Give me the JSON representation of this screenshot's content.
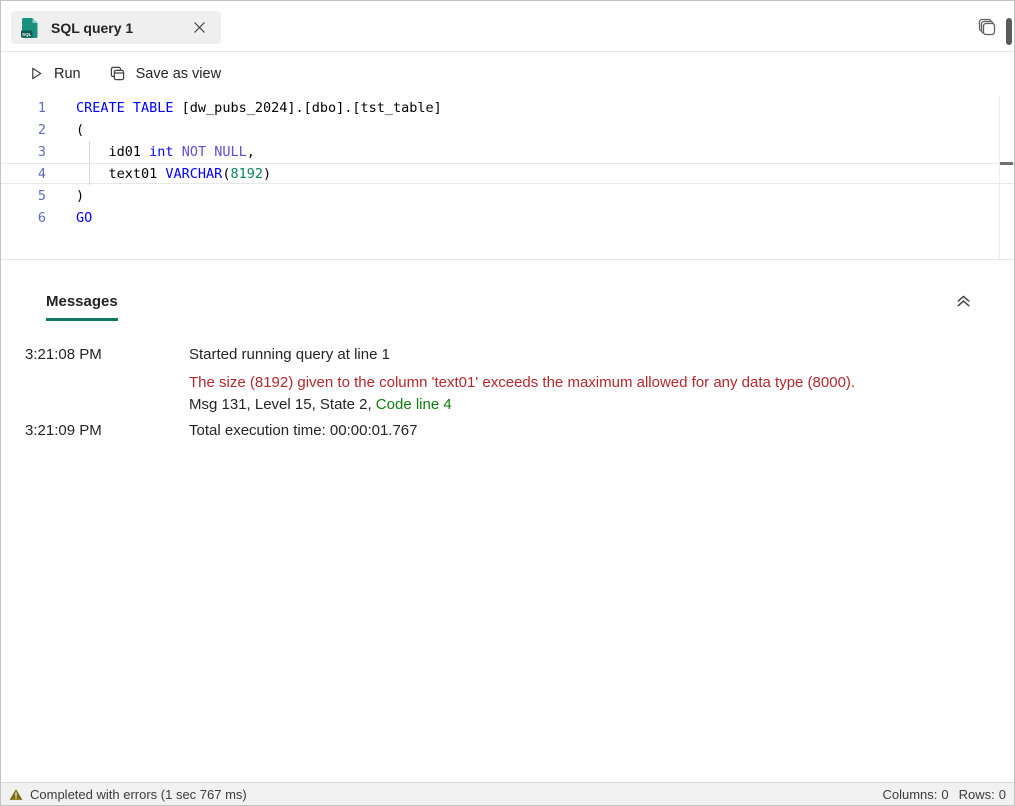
{
  "colors": {
    "accent_teal": "#117865",
    "keyword": "#0000ff",
    "keyword_alt": "#5f4fd2",
    "number": "#098658",
    "line_number": "#5c6cc0",
    "error_red": "#b3282d",
    "link_green": "#107c10",
    "warning_olive": "#7d6e18",
    "tab_background": "#efefef",
    "sql_icon_teal": "#18917f"
  },
  "tab_bar": {
    "tab": {
      "title": "SQL query 1"
    }
  },
  "icons": {
    "tab_file": "sql-file-icon",
    "tab_file_badge": "SQL",
    "tab_close": "close-icon",
    "run": "play-icon",
    "save_as_view": "save-as-view-icon",
    "duplicate": "duplicate-icon",
    "collapse": "double-chevron-up-icon",
    "status_warning": "warning-triangle-icon"
  },
  "toolbar": {
    "run_label": "Run",
    "save_as_view_label": "Save as view"
  },
  "editor": {
    "current_line": 4,
    "lines": [
      {
        "num": "1",
        "segments": [
          [
            "k",
            "CREATE TABLE"
          ],
          [
            "p",
            " [dw_pubs_2024].[dbo].[tst_table]"
          ]
        ]
      },
      {
        "num": "2",
        "segments": [
          [
            "p",
            "("
          ]
        ]
      },
      {
        "num": "3",
        "segments": [
          [
            "p",
            "    id01 "
          ],
          [
            "k",
            "int"
          ],
          [
            "p",
            " "
          ],
          [
            "k2",
            "NOT"
          ],
          [
            "p",
            " "
          ],
          [
            "k2",
            "NULL"
          ],
          [
            "p",
            ","
          ]
        ]
      },
      {
        "num": "4",
        "segments": [
          [
            "p",
            "    text01 "
          ],
          [
            "k",
            "VARCHAR"
          ],
          [
            "p",
            "("
          ],
          [
            "n",
            "8192"
          ],
          [
            "p",
            ")"
          ]
        ]
      },
      {
        "num": "5",
        "segments": [
          [
            "p",
            ")"
          ]
        ]
      },
      {
        "num": "6",
        "segments": [
          [
            "k",
            "GO"
          ]
        ]
      }
    ]
  },
  "messages_panel": {
    "tab_label": "Messages",
    "rows": [
      {
        "time": "3:21:08 PM",
        "text": "Started running query at line 1",
        "type": "info"
      },
      {
        "time": "",
        "text": "The size (8192) given to the column 'text01' exceeds the maximum allowed for any data type (8000).",
        "type": "error"
      },
      {
        "time": "",
        "text": "Msg 131, Level 15, State 2, ",
        "link_text": "Code line 4",
        "type": "meta"
      },
      {
        "time": "3:21:09 PM",
        "text": "Total execution time: 00:00:01.767",
        "type": "last"
      }
    ]
  },
  "status_bar": {
    "message": "Completed with errors (1 sec 767 ms)",
    "columns_label": "Columns:",
    "columns_value": "0",
    "rows_label": "Rows:",
    "rows_value": "0"
  }
}
